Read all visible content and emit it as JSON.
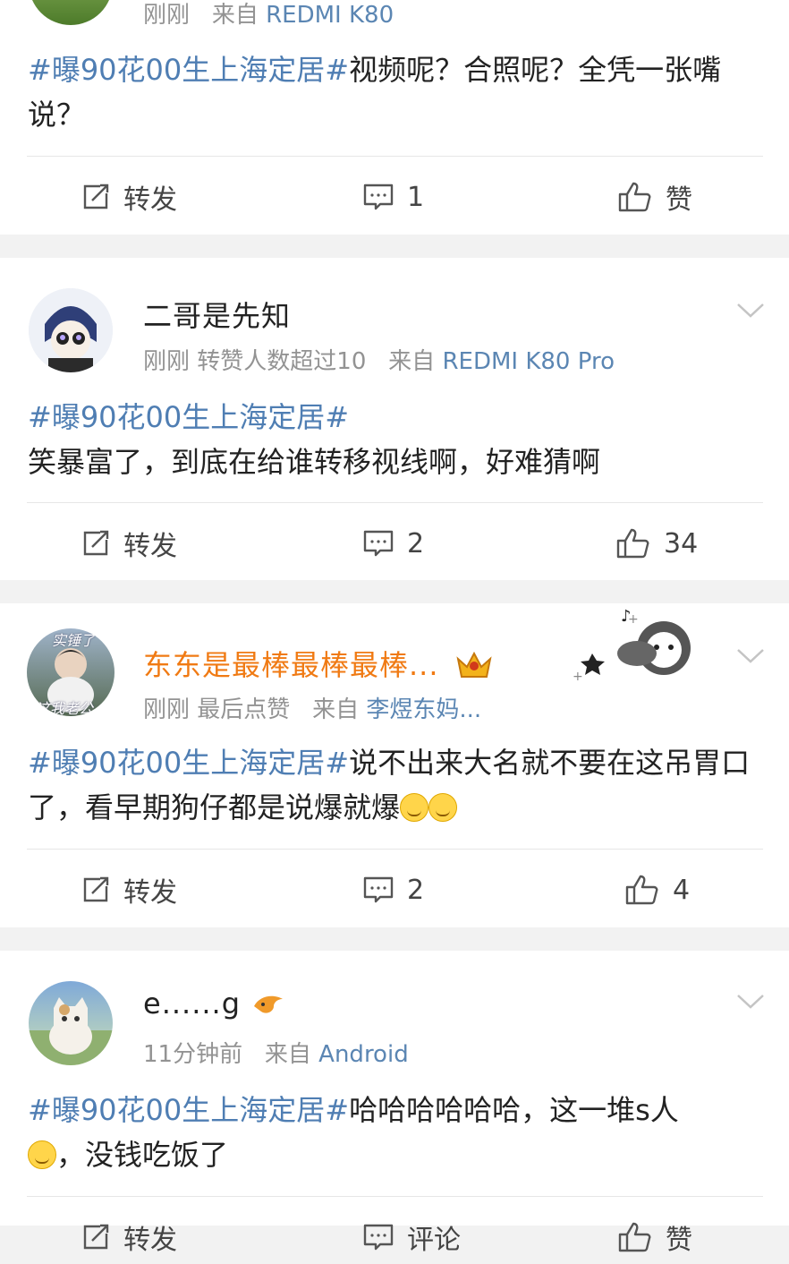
{
  "posts": [
    {
      "meta_time": "刚刚",
      "meta_from": "来自",
      "meta_source": "REDMI K80",
      "content_tag": "#曝90花00生上海定居#",
      "content_text": "视频呢？合照呢？全凭一张嘴说？",
      "repost_label": "转发",
      "comment_count": "1",
      "like_label": "赞"
    },
    {
      "user_name": "二哥是先知",
      "meta_time": "刚刚",
      "meta_extra": "转赞人数超过10",
      "meta_from": "来自",
      "meta_source": "REDMI K80 Pro",
      "content_tag": "#曝90花00生上海定居#",
      "content_text": "笑暴富了，到底在给谁转移视线啊，好难猜啊",
      "repost_label": "转发",
      "comment_count": "2",
      "like_count": "34"
    },
    {
      "user_name": "东东是最棒最棒最棒...",
      "avatar_text_top": "实锤了",
      "avatar_text_bottom": "这我老公",
      "meta_time": "刚刚",
      "meta_extra": "最后点赞",
      "meta_from": "来自",
      "meta_source": "李煜东妈...",
      "content_tag": "#曝90花00生上海定居#",
      "content_text": "说不出来大名就不要在这吊胃口了，看早期狗仔都是说爆就爆",
      "repost_label": "转发",
      "comment_count": "2",
      "like_count": "4"
    },
    {
      "user_name": "e......g",
      "meta_time": "11分钟前",
      "meta_from": "来自",
      "meta_source": "Android",
      "content_tag": "#曝90花00生上海定居#",
      "content_text_1": "哈哈哈哈哈哈，这一堆s人",
      "content_text_2": "，没钱吃饭了",
      "repost_label": "转发",
      "comment_label": "评论",
      "like_label": "赞"
    }
  ],
  "colors": {
    "tag": "#4f7eb3",
    "source": "#5b86b3",
    "name_vip": "#f07a13",
    "meta": "#939393",
    "bg": "#f2f2f2"
  }
}
